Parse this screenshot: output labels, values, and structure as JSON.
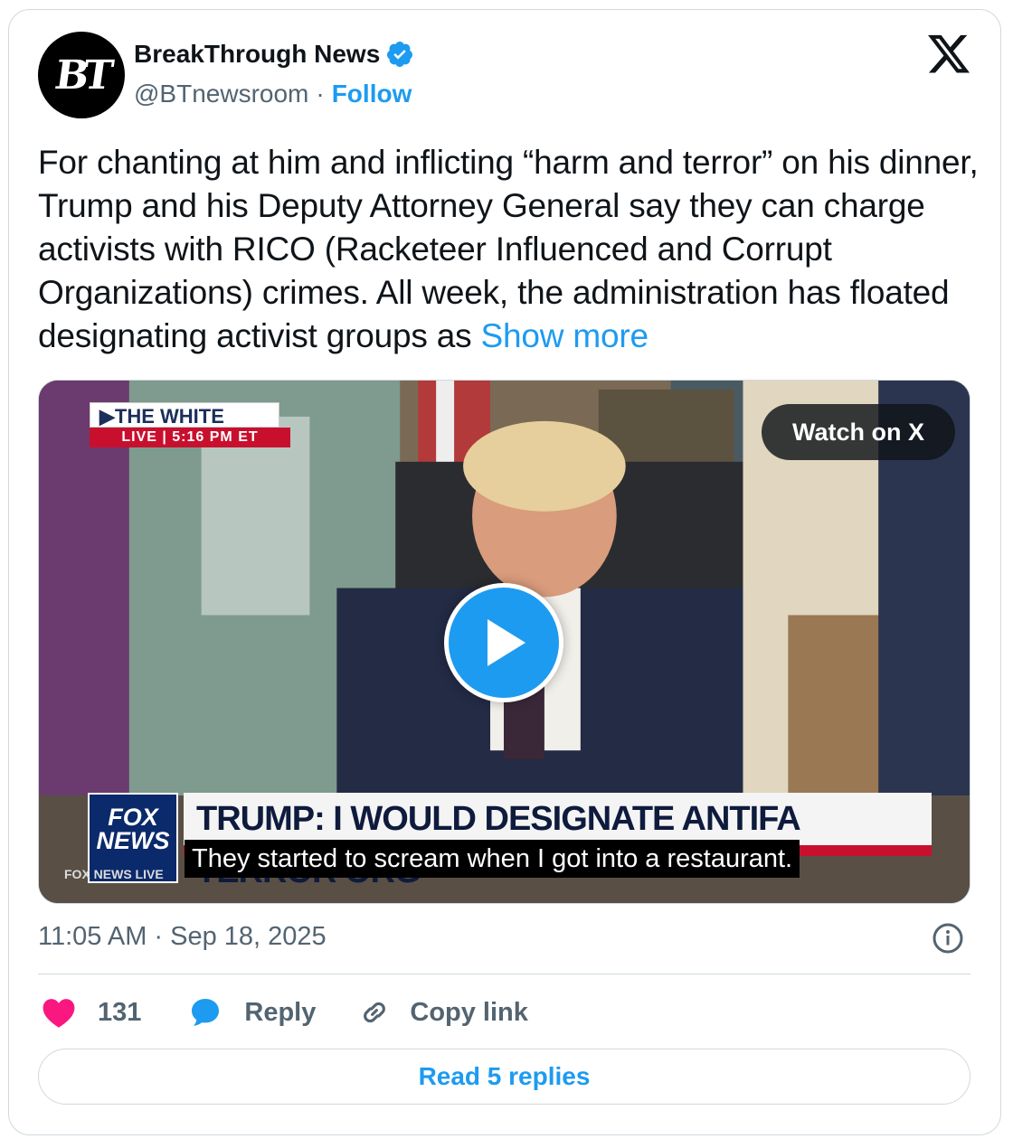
{
  "author": {
    "name": "BreakThrough News",
    "handle": "@BTnewsroom",
    "separator": "·",
    "follow_label": "Follow",
    "avatar_text": "BT",
    "verified": true
  },
  "tweet": {
    "text": "For chanting at him and inflicting “harm and terror” on his dinner, Trump and his Deputy Attorney General say they can charge activists with RICO (Racketeer Influenced and Corrupt Organizations) crimes. All week, the administration has floated designating activist groups as ",
    "show_more": "Show more"
  },
  "media": {
    "watch_label": "Watch on X",
    "badge_title": "▶THE WHITE HOUSE",
    "badge_live": "LIVE  |  5:16 PM ET",
    "network_logo": "FOX NEWS",
    "network_live": "FOX NEWS LIVE",
    "chyron": "TRUMP: I WOULD DESIGNATE ANTIFA TERROR ORG",
    "caption": "They started to scream when I got into a restaurant."
  },
  "meta": {
    "timestamp": "11:05 AM · Sep 18, 2025"
  },
  "actions": {
    "like_count": "131",
    "reply_label": "Reply",
    "copy_label": "Copy link",
    "read_replies": "Read 5 replies"
  },
  "colors": {
    "accent": "#1d9bf0",
    "like": "#f91880",
    "text": "#0f1419",
    "muted": "#536471",
    "border": "#cfd9de"
  },
  "icons": [
    "verified-badge-icon",
    "x-logo-icon",
    "play-icon",
    "info-icon",
    "heart-icon",
    "reply-bubble-icon",
    "link-icon"
  ]
}
